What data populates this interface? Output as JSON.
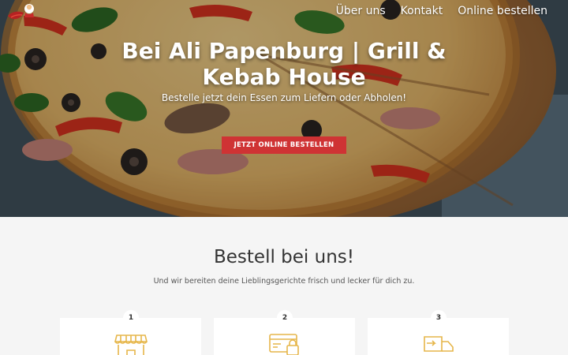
{
  "header": {
    "logo_icon": "restaurant-chef-logo",
    "nav": [
      {
        "label": "Über uns"
      },
      {
        "label": "Kontakt"
      },
      {
        "label": "Online bestellen"
      }
    ]
  },
  "hero": {
    "title": "Bei Ali Papenburg | Grill & Kebab House",
    "subtitle": "Bestelle jetzt dein Essen zum Liefern oder Abholen!",
    "cta_label": "JETZT ONLINE BESTELLEN",
    "cta_color": "#cf3334"
  },
  "section": {
    "title": "Bestell bei uns!",
    "subtitle": "Und wir bereiten deine Lieblingsgerichte frisch und lecker für dich zu."
  },
  "steps": [
    {
      "number": "1",
      "icon": "storefront-icon"
    },
    {
      "number": "2",
      "icon": "payment-card-icon"
    },
    {
      "number": "3",
      "icon": "delivery-truck-icon"
    }
  ],
  "colors": {
    "accent": "#cf3334",
    "icon_gold": "#e6b64a",
    "section_bg": "#f5f5f5"
  }
}
